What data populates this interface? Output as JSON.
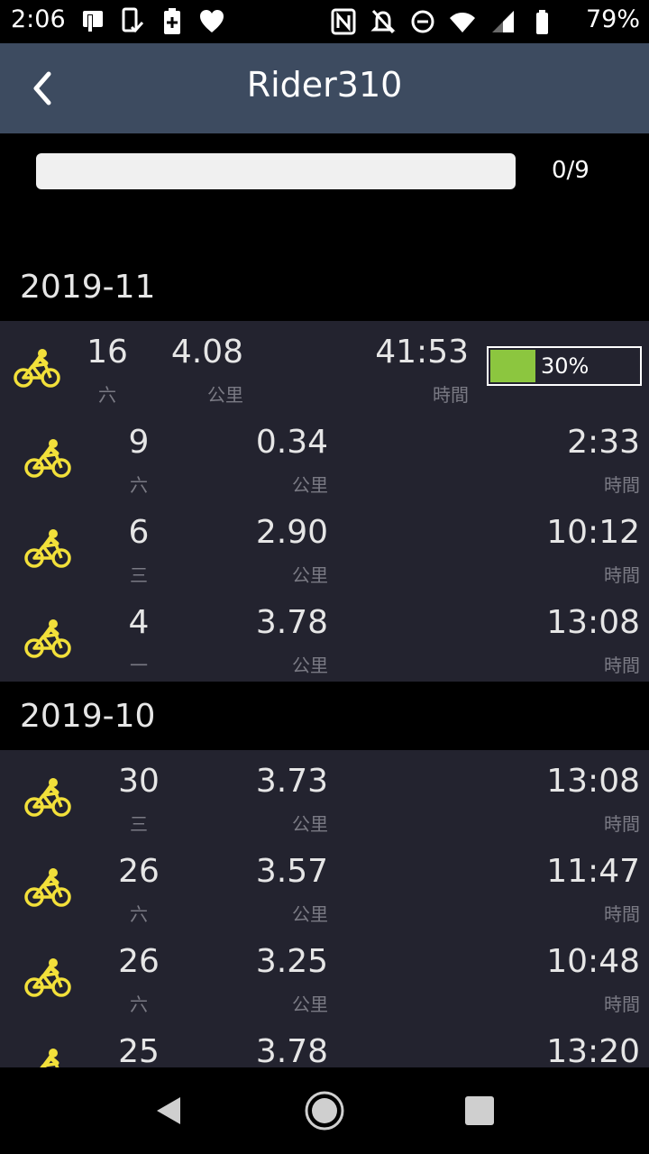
{
  "status_bar": {
    "time": "2:06",
    "battery": "79%"
  },
  "app_bar": {
    "title": "Rider310"
  },
  "sync": {
    "count": "0/9",
    "progress": 0
  },
  "months": [
    {
      "label": "2019-11",
      "rides": [
        {
          "day": "16",
          "weekday": "六",
          "distance": "4.08",
          "distance_unit": "公里",
          "duration": "41:53",
          "duration_unit": "時間",
          "upload": "30%",
          "upload_progress": 0.3
        },
        {
          "day": "9",
          "weekday": "六",
          "distance": "0.34",
          "distance_unit": "公里",
          "duration": "2:33",
          "duration_unit": "時間"
        },
        {
          "day": "6",
          "weekday": "三",
          "distance": "2.90",
          "distance_unit": "公里",
          "duration": "10:12",
          "duration_unit": "時間"
        },
        {
          "day": "4",
          "weekday": "一",
          "distance": "3.78",
          "distance_unit": "公里",
          "duration": "13:08",
          "duration_unit": "時間"
        }
      ]
    },
    {
      "label": "2019-10",
      "rides": [
        {
          "day": "30",
          "weekday": "三",
          "distance": "3.73",
          "distance_unit": "公里",
          "duration": "13:08",
          "duration_unit": "時間"
        },
        {
          "day": "26",
          "weekday": "六",
          "distance": "3.57",
          "distance_unit": "公里",
          "duration": "11:47",
          "duration_unit": "時間"
        },
        {
          "day": "26",
          "weekday": "六",
          "distance": "3.25",
          "distance_unit": "公里",
          "duration": "10:48",
          "duration_unit": "時間"
        },
        {
          "day": "25",
          "weekday": "",
          "distance": "3.78",
          "distance_unit": "",
          "duration": "13:20",
          "duration_unit": ""
        }
      ]
    }
  ],
  "colors": {
    "app_bar": "#3d4b60",
    "list_bg": "#23232f",
    "bike_icon": "#f2e03a",
    "upload_fill": "#8cc63f"
  },
  "icons": {
    "back": "chevron-left-icon",
    "ride": "bicycle-icon",
    "nav_back": "triangle-back-icon",
    "nav_home": "circle-home-icon",
    "nav_recent": "square-recent-icon"
  }
}
